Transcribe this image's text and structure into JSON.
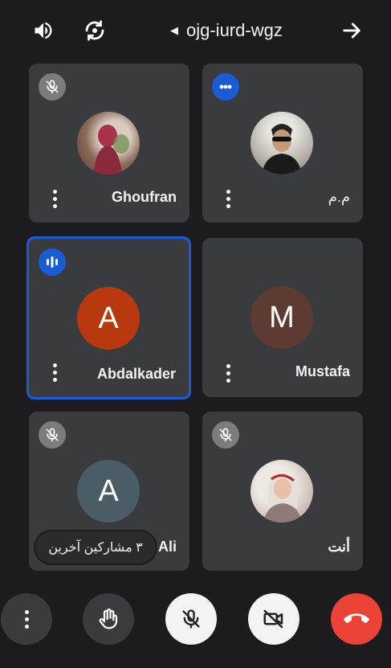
{
  "topbar": {
    "speaker_icon": "volume-up-icon",
    "switch_camera_icon": "camera-switch-icon",
    "meeting_code": "ojg-iurd-wgz",
    "leave_icon": "arrow-right-icon"
  },
  "participants": [
    {
      "name": "Ghoufran",
      "avatar_type": "photo",
      "mic": "muted"
    },
    {
      "name": "م.م",
      "avatar_type": "photo",
      "mic": "speaking"
    },
    {
      "name": "Abdalkader",
      "avatar_type": "letter",
      "letter": "A",
      "avatar_color": "#b9390f",
      "mic": "speaking",
      "active_speaker": true
    },
    {
      "name": "Mustafa",
      "avatar_type": "letter",
      "letter": "M",
      "avatar_color": "#5d3a32",
      "mic": "unmuted"
    },
    {
      "name": "Ali",
      "avatar_type": "letter",
      "letter": "A",
      "avatar_color": "#4a5c66",
      "mic": "muted"
    },
    {
      "name": "أنت",
      "avatar_type": "photo",
      "mic": "muted"
    }
  ],
  "others_pill": "٣ مشاركين آخرين",
  "controls": {
    "more_icon": "more-vert-icon",
    "raise_hand_icon": "raise-hand-icon",
    "mic_icon": "mic-off-icon",
    "camera_icon": "videocam-off-icon",
    "end_call_icon": "call-end-icon"
  },
  "colors": {
    "background": "#1c1c1e",
    "tile": "#3a3b3e",
    "active_border": "#1a5bd6",
    "end_call": "#ea4335"
  }
}
